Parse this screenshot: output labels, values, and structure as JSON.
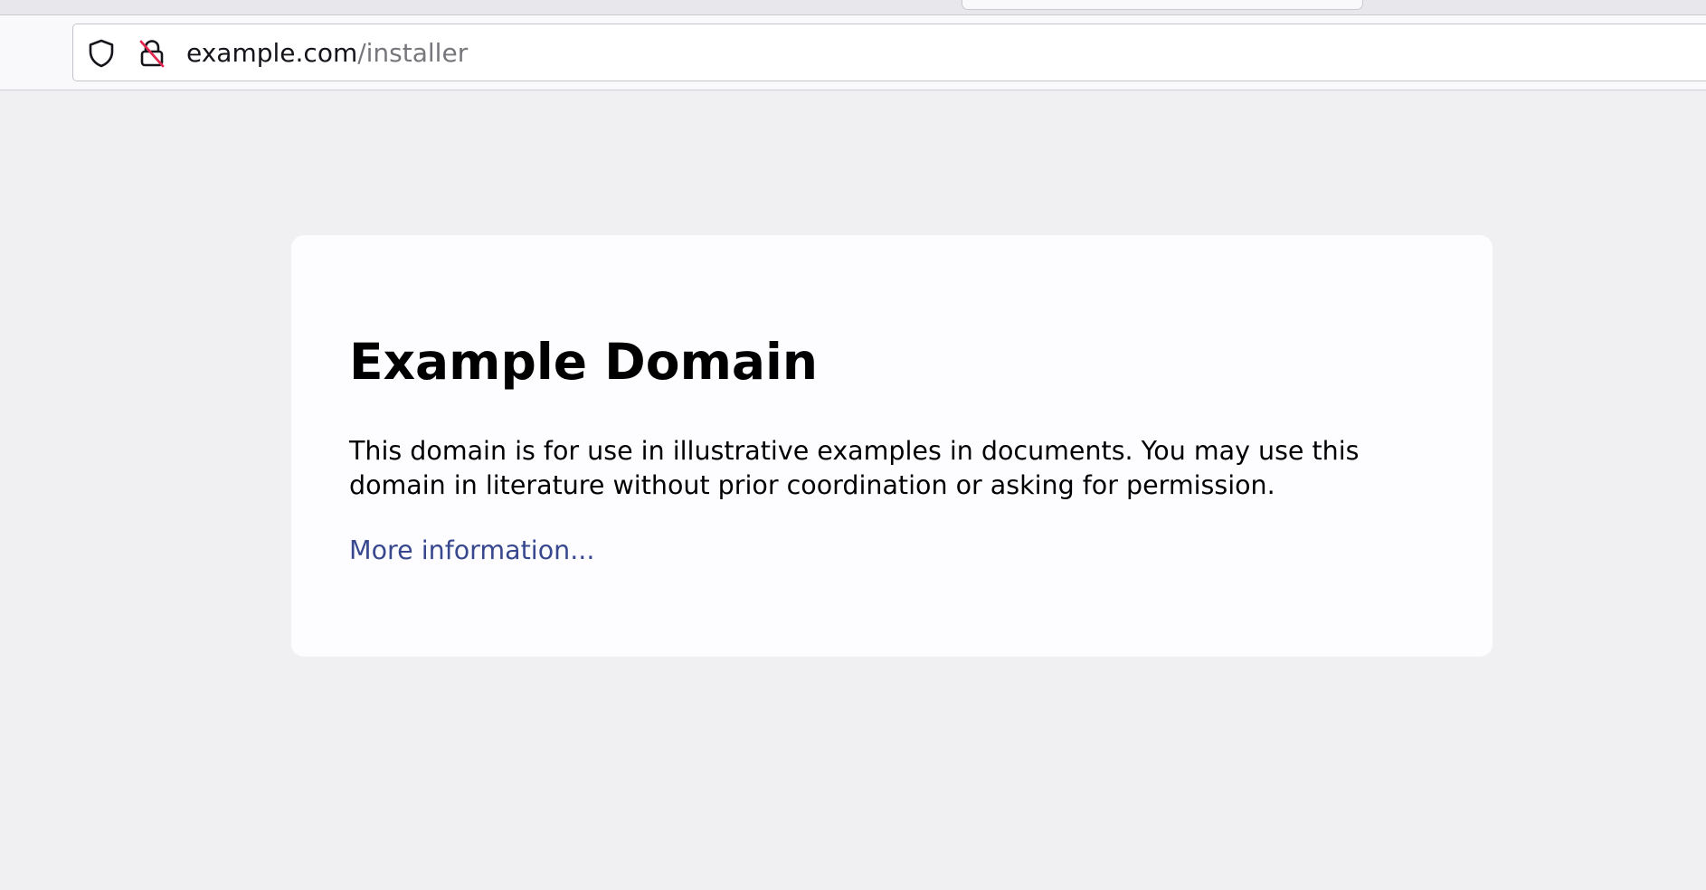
{
  "browser": {
    "toolbar": {
      "icons": {
        "tracking_protection": "shield-icon",
        "connection_status": "insecure-lock-icon"
      },
      "url": {
        "host": "example.com",
        "path": "/installer"
      }
    }
  },
  "page": {
    "heading": "Example Domain",
    "paragraph": "This domain is for use in illustrative examples in documents. You may use this domain in literature without prior coordination or asking for permission.",
    "link_text": "More information...",
    "colors": {
      "background": "#f0f0f3",
      "card": "#fdfdff",
      "link": "#38488f"
    }
  }
}
